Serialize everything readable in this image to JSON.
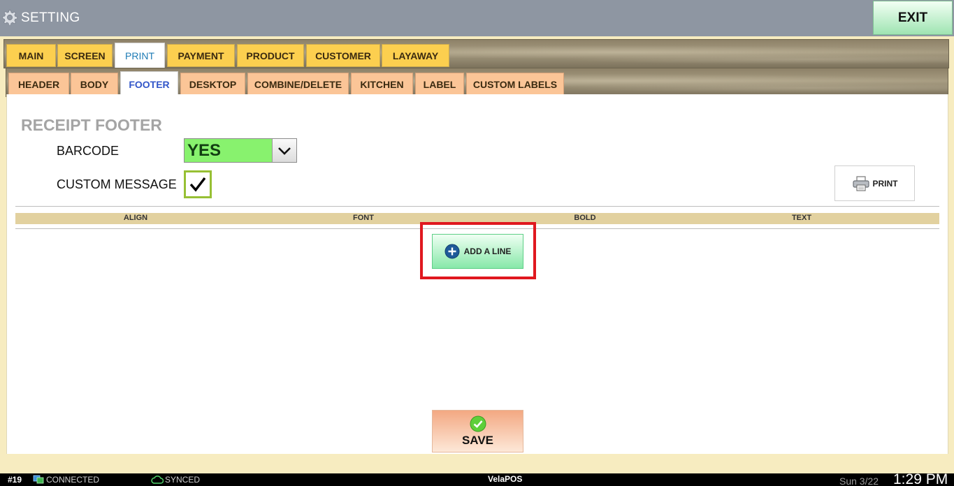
{
  "window": {
    "title": "SETTING",
    "exit_label": "EXIT"
  },
  "tabs_primary": [
    "MAIN",
    "SCREEN",
    "PRINT",
    "PAYMENT",
    "PRODUCT",
    "CUSTOMER",
    "LAYAWAY"
  ],
  "tabs_primary_active": "PRINT",
  "tabs_secondary": [
    "HEADER",
    "BODY",
    "FOOTER",
    "DESKTOP",
    "COMBINE/DELETE",
    "KITCHEN",
    "LABEL",
    "CUSTOM LABELS"
  ],
  "tabs_secondary_active": "FOOTER",
  "section": {
    "title": "RECEIPT FOOTER",
    "barcode_label": "BARCODE",
    "barcode_value": "YES",
    "custom_message_label": "CUSTOM MESSAGE",
    "custom_message_checked": true
  },
  "print_button": {
    "label": "PRINT",
    "icon": "printer-icon"
  },
  "table": {
    "columns": [
      "ALIGN",
      "FONT",
      "BOLD",
      "TEXT"
    ]
  },
  "add_line_button": {
    "label": "ADD A LINE",
    "icon": "plus-circle-icon"
  },
  "save_button": {
    "label": "SAVE",
    "icon": "check-circle-icon"
  },
  "status": {
    "station": "#19",
    "connection": "CONNECTED",
    "sync": "SYNCED",
    "brand": "VelaPOS",
    "date": "Sun 3/22",
    "time": "1:29 PM"
  },
  "colors": {
    "highlight_box": "#e0181f",
    "barcode_select_bg": "#88f26e",
    "primary_tab_bg": "#fccf4f",
    "secondary_tab_bg": "#fbc597"
  }
}
